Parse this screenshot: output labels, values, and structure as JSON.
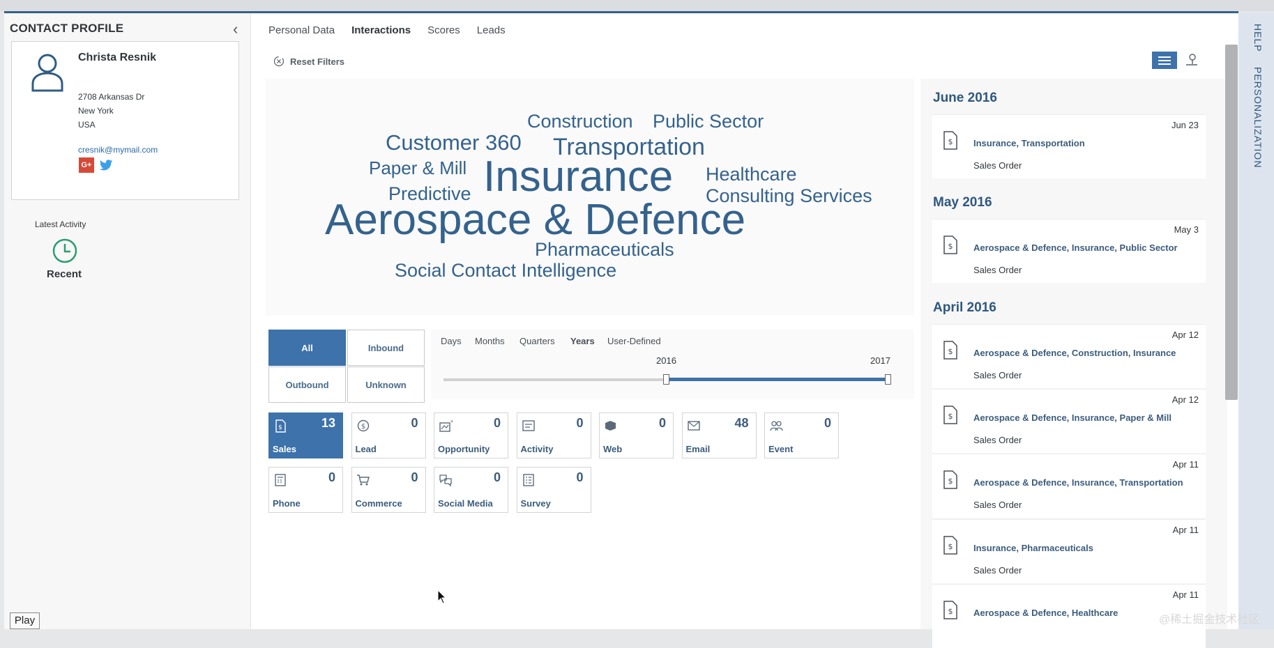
{
  "profile": {
    "title": "CONTACT PROFILE",
    "name": "Christa Resnik",
    "address_line1": "2708 Arkansas Dr",
    "address_line2": "New York",
    "address_line3": "USA",
    "email": "cresnik@mymail.com",
    "gplus": "G+",
    "latest_activity_label": "Latest Activity",
    "recent_label": "Recent"
  },
  "tabs": [
    "Personal Data",
    "Interactions",
    "Scores",
    "Leads"
  ],
  "active_tab": "Interactions",
  "reset_filters": "Reset Filters",
  "word_cloud": [
    {
      "text": "Construction"
    },
    {
      "text": "Public Sector"
    },
    {
      "text": "Customer 360"
    },
    {
      "text": "Transportation"
    },
    {
      "text": "Paper & Mill"
    },
    {
      "text": "Insurance"
    },
    {
      "text": "Healthcare"
    },
    {
      "text": "Predictive"
    },
    {
      "text": "Consulting Services"
    },
    {
      "text": "Aerospace & Defence"
    },
    {
      "text": "Pharmaceuticals"
    },
    {
      "text": "Social Contact Intelligence"
    }
  ],
  "direction_filters": {
    "all": "All",
    "inbound": "Inbound",
    "outbound": "Outbound",
    "unknown": "Unknown",
    "selected": "All"
  },
  "granularity": {
    "days": "Days",
    "months": "Months",
    "quarters": "Quarters",
    "years": "Years",
    "user_defined": "User-Defined",
    "selected": "Years"
  },
  "slider": {
    "start_label": "2016",
    "end_label": "2017",
    "range_start_fraction": 0.5,
    "range_end_fraction": 1.0
  },
  "tiles": [
    {
      "label": "Sales",
      "count": "13",
      "icon": "sales-doc-icon",
      "selected": true
    },
    {
      "label": "Lead",
      "count": "0",
      "icon": "dollar-coin-icon"
    },
    {
      "label": "Opportunity",
      "count": "0",
      "icon": "opportunity-icon"
    },
    {
      "label": "Activity",
      "count": "0",
      "icon": "activity-icon"
    },
    {
      "label": "Web",
      "count": "0",
      "icon": "web-icon"
    },
    {
      "label": "Email",
      "count": "48",
      "icon": "email-icon"
    },
    {
      "label": "Event",
      "count": "0",
      "icon": "event-icon"
    },
    {
      "label": "Phone",
      "count": "0",
      "icon": "phone-icon"
    },
    {
      "label": "Commerce",
      "count": "0",
      "icon": "cart-icon"
    },
    {
      "label": "Social Media",
      "count": "0",
      "icon": "social-media-icon"
    },
    {
      "label": "Survey",
      "count": "0",
      "icon": "survey-icon"
    }
  ],
  "timeline": {
    "months": [
      {
        "label": "June 2016"
      },
      {
        "label": "May 2016"
      },
      {
        "label": "April 2016"
      }
    ],
    "entries": [
      {
        "date": "Jun 23",
        "title": "Insurance, Transportation",
        "type": "Sales Order"
      },
      {
        "date": "May 3",
        "title": "Aerospace & Defence, Insurance, Public Sector",
        "type": "Sales Order"
      },
      {
        "date": "Apr 12",
        "title": "Aerospace & Defence, Construction, Insurance",
        "type": "Sales Order"
      },
      {
        "date": "Apr 12",
        "title": "Aerospace & Defence, Insurance, Paper & Mill",
        "type": "Sales Order"
      },
      {
        "date": "Apr 11",
        "title": "Aerospace & Defence, Insurance, Transportation",
        "type": "Sales Order"
      },
      {
        "date": "Apr 11",
        "title": "Insurance, Pharmaceuticals",
        "type": "Sales Order"
      },
      {
        "date": "Apr 11",
        "title": "Aerospace & Defence, Healthcare",
        "type": ""
      }
    ]
  },
  "side_panel": {
    "help": "HELP",
    "personalization": "PERSONALIZATION"
  },
  "play_button": "Play",
  "watermark": "@稀土掘金技术社区",
  "colors": {
    "accent": "#3d72ab",
    "cloud_text": "#34628d",
    "header_line": "#346187"
  }
}
